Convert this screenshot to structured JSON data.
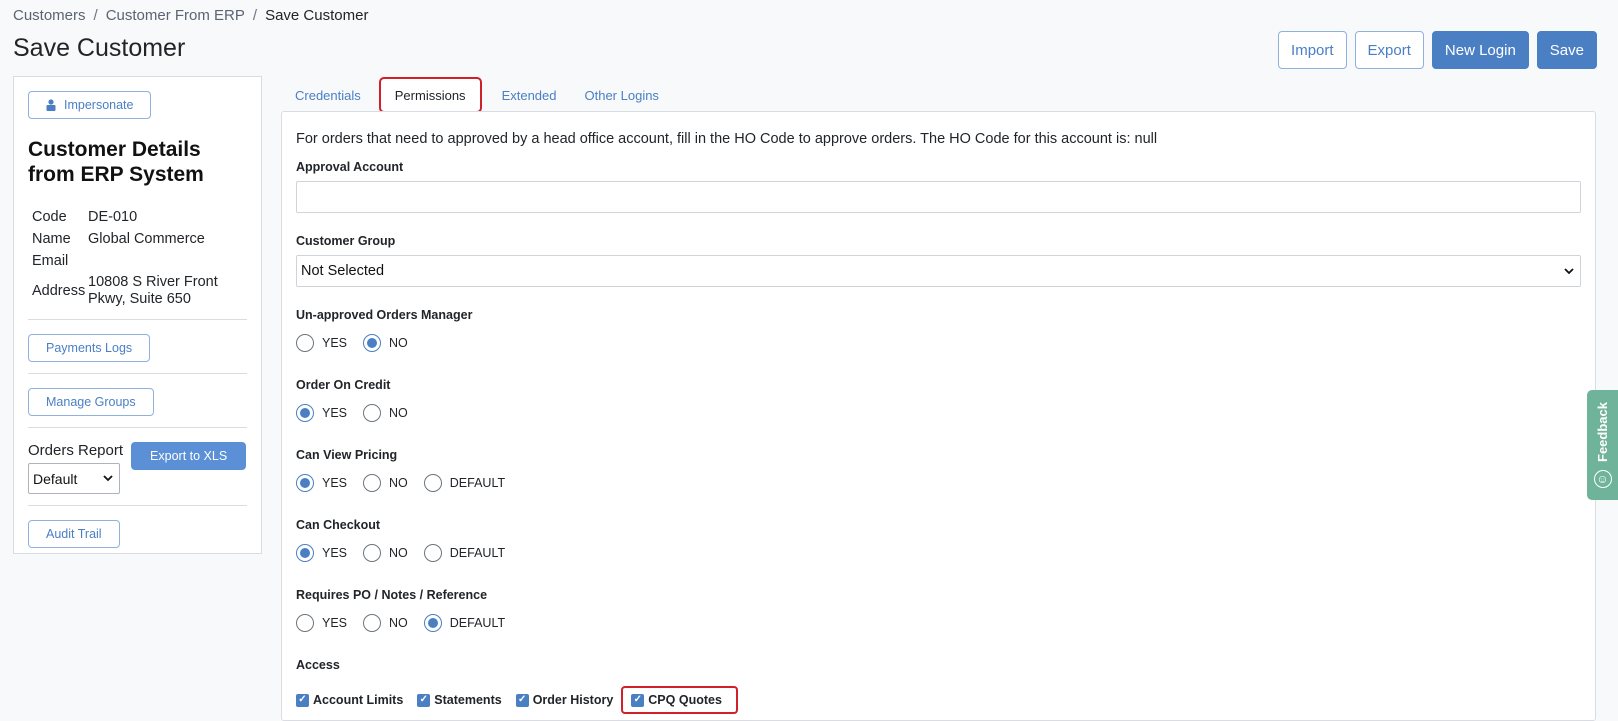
{
  "breadcrumb": {
    "items": [
      "Customers",
      "Customer From ERP",
      "Save Customer"
    ],
    "separator": "/"
  },
  "page_title": "Save Customer",
  "actions": {
    "import_label": "Import",
    "export_label": "Export",
    "new_login_label": "New Login",
    "save_label": "Save"
  },
  "sidebar": {
    "impersonate_label": "Impersonate",
    "title": "Customer Details from ERP System",
    "details": {
      "code_key": "Code",
      "code_val": "DE-010",
      "name_key": "Name",
      "name_val": "Global Commerce",
      "email_key": "Email",
      "email_val": "",
      "address_key": "Address",
      "address_val": "10808 S River Front Pkwy, Suite 650"
    },
    "payments_logs_label": "Payments Logs",
    "manage_groups_label": "Manage Groups",
    "orders_report_label": "Orders Report",
    "orders_report_value": "Default",
    "export_xls_label": "Export to XLS",
    "audit_trail_label": "Audit Trail"
  },
  "tabs": [
    "Credentials",
    "Permissions",
    "Extended",
    "Other Logins"
  ],
  "active_tab": "Permissions",
  "permissions": {
    "intro": "For orders that need to approved by a head office account, fill in the HO Code to approve orders. The HO Code for this account is: null",
    "approval_account_label": "Approval Account",
    "approval_account_value": "",
    "customer_group_label": "Customer Group",
    "customer_group_value": "Not Selected",
    "unapproved_manager_label": "Un-approved Orders Manager",
    "order_on_credit_label": "Order On Credit",
    "can_view_pricing_label": "Can View Pricing",
    "can_checkout_label": "Can Checkout",
    "requires_po_label": "Requires PO / Notes / Reference",
    "yes": "YES",
    "no": "NO",
    "default": "DEFAULT",
    "access_label": "Access",
    "access": {
      "account_limits": "Account Limits",
      "statements": "Statements",
      "order_history": "Order History",
      "cpq_quotes": "CPQ Quotes"
    }
  },
  "feedback_label": "Feedback",
  "colors": {
    "primary": "#4a7fc4",
    "highlight": "#d0202a",
    "feedback": "#6fb49a"
  }
}
